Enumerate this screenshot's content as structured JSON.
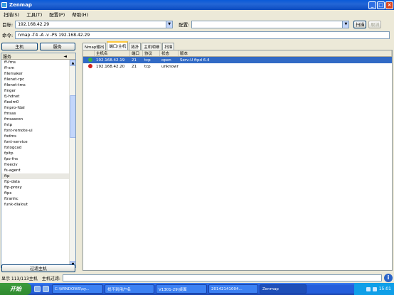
{
  "window": {
    "title": "Zenmap"
  },
  "menu": [
    "扫描(S)",
    "工具(T)",
    "配置(P)",
    "帮助(H)"
  ],
  "target": {
    "label": "目标:",
    "value": "192.168.42.29"
  },
  "profile": {
    "label": "配置:",
    "value": ""
  },
  "buttons": {
    "scan": "扫描",
    "cancel": "取消",
    "hosts": "主机",
    "services": "服务",
    "filter_hosts": "过滤主机"
  },
  "command": {
    "label": "命令:",
    "value": "nmap -T4 -A -v -PS 192.168.42.29"
  },
  "service_list": {
    "header": "服务",
    "items": [
      "ff-fms",
      "ff-sm",
      "filemaker",
      "filenet-rpc",
      "filenet-tms",
      "finger",
      "fj-hdnet",
      "flexlm0",
      "fmpro-fdal",
      "fmsas",
      "fmsascon",
      "fntp",
      "font-remote-ui",
      "fodms",
      "font-service",
      "fotogcad",
      "fpitp",
      "fpo-fns",
      "freeciv",
      "fs-agent",
      "ftp",
      "ftp-data",
      "ftp-proxy",
      "ftps",
      "ftranhc",
      "funk-dialout"
    ],
    "selected": "ftp"
  },
  "tabs": [
    "Nmap输出",
    "端口/主机",
    "拓扑",
    "主机明细",
    "扫描"
  ],
  "active_tab": "端口/主机",
  "ports_table": {
    "columns": [
      "",
      "主机名",
      "端口",
      "协议",
      "状态",
      "版本"
    ],
    "rows": [
      {
        "status_color": "#3cb43c",
        "host": "192.168.42.19",
        "port": "21",
        "protocol": "tcp",
        "state": "open",
        "version": "Serv-U ftpd 6.4"
      },
      {
        "status_color": "#d02020",
        "host": "192.168.42.20",
        "port": "21",
        "protocol": "tcp",
        "state": "unknown",
        "version": ""
      }
    ]
  },
  "statusbar": {
    "text": "显示 113/113主机",
    "filter_label": "主机过滤:"
  },
  "taskbar": {
    "start": "开始",
    "tasks": [
      "C:\\WINDOWS\\sy...",
      "找不到用户名",
      "V1301-29\\桌面",
      "20142141004...",
      "Zenmap"
    ],
    "active_task": "Zenmap",
    "clock": "15:01"
  }
}
